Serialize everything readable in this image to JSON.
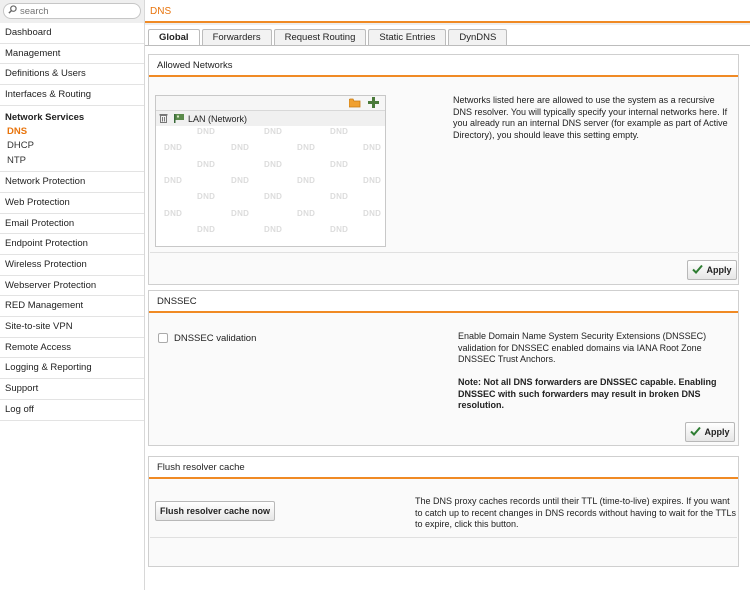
{
  "sidebar": {
    "search_placeholder": "search",
    "items_top": [
      "Dashboard",
      "Management",
      "Definitions & Users",
      "Interfaces & Routing"
    ],
    "group": {
      "title": "Network Services",
      "subitems": [
        "DNS",
        "DHCP",
        "NTP"
      ]
    },
    "items_bottom": [
      "Network Protection",
      "Web Protection",
      "Email Protection",
      "Endpoint Protection",
      "Wireless Protection",
      "Webserver Protection",
      "RED Management",
      "Site-to-site VPN",
      "Remote Access",
      "Logging & Reporting",
      "Support",
      "Log off"
    ]
  },
  "page": {
    "title": "DNS"
  },
  "tabs": [
    "Global",
    "Forwarders",
    "Request Routing",
    "Static Entries",
    "DynDNS"
  ],
  "allowed_networks": {
    "title": "Allowed Networks",
    "entry": "LAN (Network)",
    "dnd_label": "DND",
    "description": "Networks listed here are allowed to use the system as a recursive DNS resolver. You will typically specify your internal networks here. If you already run an internal DNS server (for example as part of Active Directory), you should leave this setting empty.",
    "apply_label": "Apply"
  },
  "dnssec": {
    "title": "DNSSEC",
    "checkbox_label": "DNSSEC validation",
    "description": "Enable Domain Name System Security Extensions (DNSSEC) validation for DNSSEC enabled domains via IANA Root Zone DNSSEC Trust Anchors.",
    "note": "Note: Not all DNS forwarders are DNSSEC capable. Enabling DNSSEC with such forwarders may result in broken DNS resolution.",
    "apply_label": "Apply"
  },
  "flush": {
    "title": "Flush resolver cache",
    "button_label": "Flush resolver cache now",
    "description": "The DNS proxy caches records until their TTL (time-to-live) expires. If you want to catch up to recent changes in DNS records without having to wait for the TTLs to expire, click this button."
  },
  "colors": {
    "accent": "#f08a24",
    "active_text": "#e8740c"
  }
}
